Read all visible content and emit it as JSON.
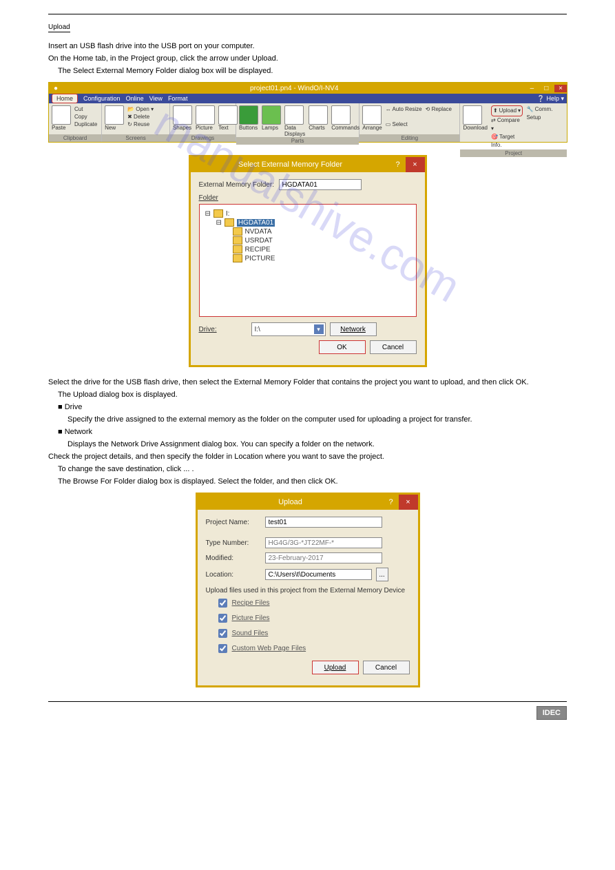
{
  "header_label": "Upload",
  "intro_steps": {
    "s1": "Insert an USB flash drive into the USB port on your computer.",
    "s2": "On the Home tab, in the Project group, click the arrow under Upload.",
    "s3": "The Select External Memory Folder dialog box will be displayed."
  },
  "ribbon": {
    "title": "project01.pn4 - WindO/I-NV4",
    "help": "Help",
    "tabs": [
      "Home",
      "Configuration",
      "Online",
      "View",
      "Format"
    ],
    "groups": {
      "clipboard": {
        "label": "Clipboard",
        "items": [
          "Paste",
          "Cut",
          "Copy",
          "Duplicate"
        ]
      },
      "screens": {
        "label": "Screens",
        "items": [
          "New",
          "Open",
          "Delete",
          "Reuse"
        ]
      },
      "drawings": {
        "label": "Drawings",
        "items": [
          "Shapes",
          "Picture",
          "Text"
        ]
      },
      "parts": {
        "label": "Parts",
        "items": [
          "Buttons",
          "Lamps",
          "Data Displays",
          "Charts",
          "Commands"
        ]
      },
      "editing": {
        "label": "Editing",
        "items": [
          "Arrange",
          "Auto Resize",
          "Select",
          "Replace"
        ]
      },
      "project": {
        "label": "Project",
        "items": [
          "Download",
          "Upload",
          "Compare",
          "Comm. Setup",
          "Target Info."
        ]
      }
    }
  },
  "dlg1": {
    "title": "Select External Memory Folder",
    "ext_label": "External Memory Folder:",
    "ext_value": "HGDATA01",
    "folder_label": "Folder",
    "tree": {
      "root": "I:",
      "sel": "HGDATA01",
      "children": [
        "NVDATA",
        "USRDAT",
        "RECIPE",
        "PICTURE"
      ]
    },
    "drive_label": "Drive:",
    "drive_value": "I:\\",
    "network": "Network",
    "ok": "OK",
    "cancel": "Cancel"
  },
  "mid_text": {
    "m1": "Select the drive for the USB flash drive, then select the External Memory Folder that contains the project you want to upload, and then click OK.",
    "m2": "The Upload dialog box is displayed.",
    "m3": "■ Drive",
    "m3b": "Specify the drive assigned to the external memory as the folder on the computer used for uploading a project for transfer.",
    "m4": "■ Network",
    "m4b": "Displays the Network Drive Assignment dialog box. You can specify a folder on the network.",
    "m5": "Check the project details, and then specify the folder in Location where you want to save the project.",
    "m6": "To change the save destination, click ... .",
    "m7": "The Browse For Folder dialog box is displayed. Select the folder, and then click OK."
  },
  "dlg2": {
    "title": "Upload",
    "pn_label": "Project Name:",
    "pn_value": "test01",
    "tn_label": "Type Number:",
    "tn_value": "HG4G/3G-*JT22MF-*",
    "mod_label": "Modified:",
    "mod_value": "23-February-2017",
    "loc_label": "Location:",
    "loc_value": "C:\\Users\\t\\Documents",
    "chk_title": "Upload files used in this project from the External Memory Device",
    "cb1": "Recipe Files",
    "cb2": "Picture Files",
    "cb3": "Sound Files",
    "cb4": "Custom Web Page Files",
    "upload": "Upload",
    "cancel": "Cancel"
  },
  "footer": {
    "left": "",
    "logo": "IDEC"
  },
  "watermark": "manualshive.com"
}
